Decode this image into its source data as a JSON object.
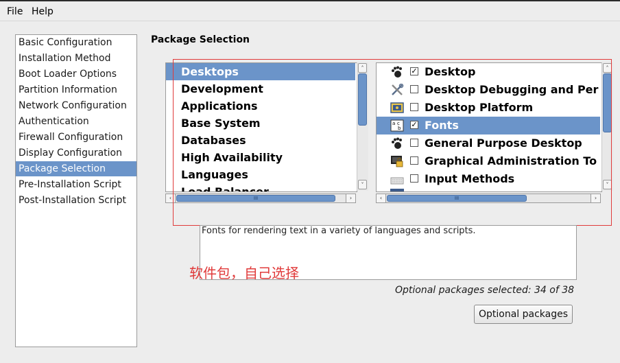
{
  "menubar": {
    "items": [
      "File",
      "Help"
    ]
  },
  "nav": {
    "items": [
      "Basic Configuration",
      "Installation Method",
      "Boot Loader Options",
      "Partition Information",
      "Network Configuration",
      "Authentication",
      "Firewall Configuration",
      "Display Configuration",
      "Package Selection",
      "Pre-Installation Script",
      "Post-Installation Script"
    ],
    "selected_index": 8
  },
  "main": {
    "title": "Package Selection",
    "groups": {
      "items": [
        "Desktops",
        "Development",
        "Applications",
        "Base System",
        "Databases",
        "High Availability",
        "Languages",
        "Load Balancer"
      ],
      "selected_index": 0
    },
    "packages": {
      "items": [
        {
          "label": "Desktop",
          "checked": true,
          "icon": "gnome-foot-icon"
        },
        {
          "label": "Desktop Debugging and Per",
          "checked": false,
          "icon": "tools-icon"
        },
        {
          "label": "Desktop Platform",
          "checked": false,
          "icon": "platform-icon"
        },
        {
          "label": "Fonts",
          "checked": true,
          "icon": "font-icon"
        },
        {
          "label": "General Purpose Desktop",
          "checked": false,
          "icon": "gnome-foot-icon"
        },
        {
          "label": "Graphical Administration To",
          "checked": false,
          "icon": "admin-lock-icon"
        },
        {
          "label": "Input Methods",
          "checked": false,
          "icon": "keyboard-icon"
        }
      ],
      "selected_index": 3
    },
    "scroll_glyphs": {
      "up": "˄",
      "down": "˅",
      "left": "‹",
      "right": "›",
      "grip_v": "≡",
      "grip_h": "III"
    },
    "description": "Fonts for rendering text in a variety of languages and scripts.",
    "annotation": "软件包，自己选择",
    "status": "Optional packages selected: 34 of 38",
    "optional_button": "Optional packages"
  },
  "colors": {
    "selection": "#6b94c9",
    "annotation": "#e03a3a",
    "background": "#ededed"
  }
}
